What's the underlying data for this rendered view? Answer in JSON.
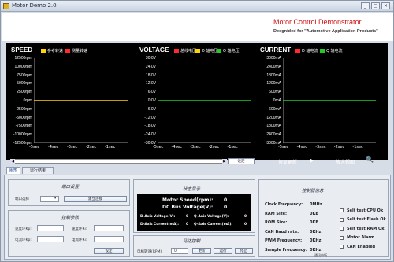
{
  "window": {
    "title": "Motor Demo 2.0",
    "controls": [
      "_",
      "□",
      "×"
    ]
  },
  "header": {
    "title": "Motor Control Demonstrator",
    "subtitle": "Desgnided for \"Automotive Application Products\""
  },
  "chart_data": [
    {
      "type": "line",
      "title": "SPEED",
      "legend": [
        {
          "name": "参考转速",
          "color": "#ffd400"
        },
        {
          "name": "测量转速",
          "color": "#ff2a2a"
        }
      ],
      "yticks": [
        "12500rpm",
        "10000rpm",
        "7500rpm",
        "5000rpm",
        "2500rpm",
        "0rpm",
        "-2500rpm",
        "-5000rpm",
        "-7500rpm",
        "-10000rpm",
        "-12500rpm"
      ],
      "ylim": [
        -12500,
        12500
      ],
      "xticks": [
        "-5sec",
        "-4sec",
        "-3sec",
        "-2sec",
        "-1sec"
      ],
      "xlim": [
        -5,
        0
      ],
      "series": [
        {
          "name": "参考转速",
          "color": "#ffd400",
          "x": [
            -5,
            0
          ],
          "y": [
            0,
            0
          ]
        }
      ]
    },
    {
      "type": "line",
      "title": "VOLTAGE",
      "legend": [
        {
          "name": "总线电压",
          "color": "#ff2a2a"
        },
        {
          "name": "D 轴电压",
          "color": "#ffd400"
        },
        {
          "name": "Q 轴电压",
          "color": "#22cc22"
        }
      ],
      "yticks": [
        "30.0V",
        "24.0V",
        "18.0V",
        "12.0V",
        "6.0V",
        "0.0V",
        "-6.0V",
        "-12.0V",
        "-18.0V",
        "-24.0V",
        "-30.0V"
      ],
      "ylim": [
        -30,
        30
      ],
      "xticks": [
        "-5sec",
        "-4sec",
        "-3sec",
        "-2sec",
        "-1sec"
      ],
      "xlim": [
        -5,
        0
      ],
      "series": [
        {
          "name": "Q 轴电压",
          "color": "#22cc22",
          "x": [
            -5,
            0
          ],
          "y": [
            0,
            0
          ]
        }
      ]
    },
    {
      "type": "line",
      "title": "CURRENT",
      "legend": [
        {
          "name": "D 轴电流",
          "color": "#ff2a2a"
        },
        {
          "name": "Q 轴电流",
          "color": "#22cc22"
        }
      ],
      "yticks": [
        "3000mA",
        "2400mA",
        "1800mA",
        "1200mA",
        "600mA",
        "0mA",
        "-600mA",
        "-1200mA",
        "-1800mA",
        "-2400mA",
        "-3000mA"
      ],
      "ylim": [
        -3000,
        3000
      ],
      "xticks": [
        "-5sec",
        "-4sec",
        "-3sec",
        "-2sec",
        "-1sec"
      ],
      "xlim": [
        -5,
        0
      ],
      "series": [
        {
          "name": "Q 轴电流",
          "color": "#22cc22",
          "x": [
            -5,
            0
          ],
          "y": [
            0,
            0
          ]
        }
      ]
    }
  ],
  "chart_controls": {
    "set_button": "设定",
    "restore_label": "恢复更新",
    "zoom_label": "放大视图"
  },
  "tabs": [
    "图形",
    "运行结果"
  ],
  "port": {
    "title": "端口设置",
    "port_label": "端口选择",
    "connect_button": "建立连接"
  },
  "control_params": {
    "title": "控制参数",
    "speed_kp": "速度环Kp:",
    "speed_ki": "速度环Ki:",
    "current_kp": "电流环Kp:",
    "current_ki": "电流环Ki:",
    "set_button": "设定"
  },
  "status": {
    "title": "状态显示",
    "motor_speed_label": "Motor Speed(rpm):",
    "motor_speed": "0",
    "dc_bus_label": "DC Bus Voltage(V):",
    "dc_bus": "0",
    "d_axis_v_label": "D-Axis Voltage(V):",
    "d_axis_v": "0",
    "q_axis_v_label": "Q-Axis Voltage(V):",
    "q_axis_v": "0",
    "d_axis_i_label": "D-Axis Current(mA):",
    "d_axis_i": "0",
    "q_axis_i_label": "Q-Axis Current(mA):",
    "q_axis_i": "0"
  },
  "motor": {
    "title": "马达控制",
    "speed_label": "电机转速(RPM)",
    "speed_value": "0",
    "update_button": "更新",
    "run_button": "运行",
    "stop_button": "停止"
  },
  "controller": {
    "title": "控制器信息",
    "rows": [
      {
        "label": "Clock Frequency:",
        "value": "0MHz"
      },
      {
        "label": "RAM Size:",
        "value": "0KB"
      },
      {
        "label": "ROM Size:",
        "value": "0KB"
      },
      {
        "label": "CAN Baud rate:",
        "value": "0KHz"
      },
      {
        "label": "PWM Frequency:",
        "value": "0KHz"
      },
      {
        "label": "Sample Frequency:",
        "value": "0KHz"
      }
    ],
    "checks": [
      "Self test CPU Ok",
      "Self test Flash Ok",
      "Self test RAM Ok",
      "Motor Alarm",
      "CAN Enabled"
    ],
    "status_text": "通讯中断"
  }
}
